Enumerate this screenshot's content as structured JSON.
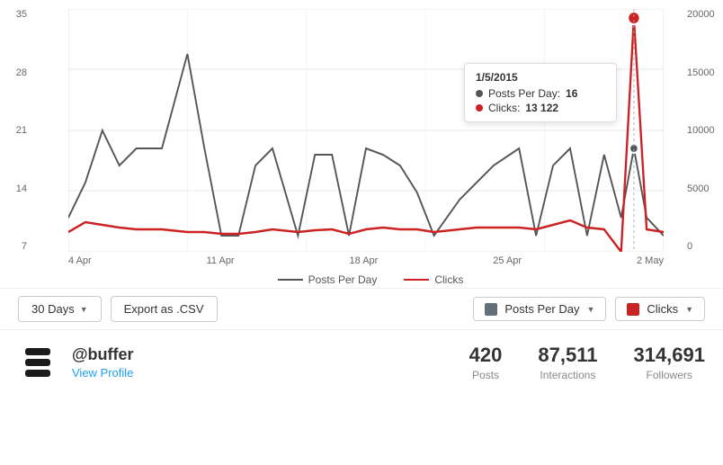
{
  "chart": {
    "yAxisLeft": [
      "35",
      "28",
      "21",
      "14",
      "7"
    ],
    "yAxisRight": [
      "20000",
      "15000",
      "10000",
      "5000",
      "0"
    ],
    "xAxisLabels": [
      "4 Apr",
      "11 Apr",
      "18 Apr",
      "25 Apr",
      "2 May"
    ],
    "tooltip": {
      "date": "1/5/2015",
      "postsLabel": "Posts Per Day:",
      "postsValue": "16",
      "clicksLabel": "Clicks:",
      "clicksValue": "13 122"
    },
    "legend": {
      "item1": "— Posts Per Day",
      "item2": "— Clicks"
    }
  },
  "controls": {
    "daysButton": "30 Days",
    "exportButton": "Export as .CSV",
    "postsPerDayToggle": "Posts Per Day",
    "clicksToggle": "Clicks"
  },
  "footer": {
    "accountHandle": "@buffer",
    "viewProfile": "View Profile",
    "stats": [
      {
        "value": "420",
        "label": "Posts"
      },
      {
        "value": "87,511",
        "label": "Interactions"
      },
      {
        "value": "314,691",
        "label": "Followers"
      }
    ]
  },
  "colors": {
    "postsLine": "#555555",
    "clicksLine": "#cc2222",
    "swatchPosts": "#636e7b",
    "swatchClicks": "#cc2222",
    "tooltipDotPosts": "#555555",
    "tooltipDotClicks": "#cc2222"
  }
}
